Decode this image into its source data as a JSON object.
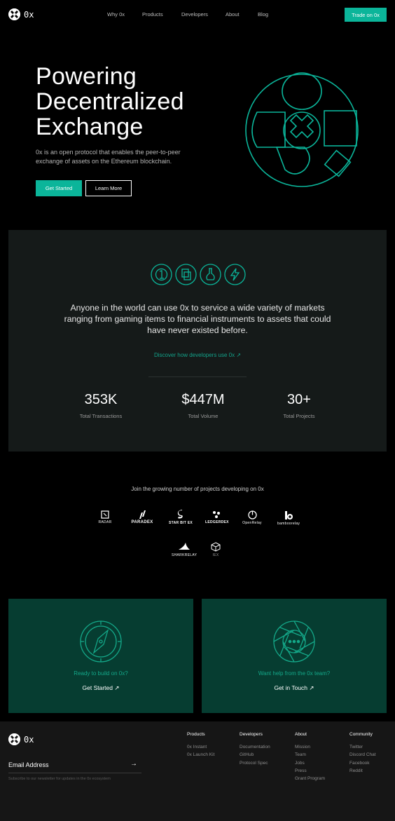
{
  "nav": {
    "logo_text": "0x",
    "links": [
      "Why 0x",
      "Products",
      "Developers",
      "About",
      "Blog"
    ],
    "cta_label": "Trade on 0x"
  },
  "hero": {
    "title_lines": [
      "Powering",
      "Decentralized",
      "Exchange"
    ],
    "subtitle": "0x is an open protocol that enables the peer-to-peer exchange of assets on the Ethereum blockchain.",
    "primary_button": "Get Started",
    "secondary_button": "Learn More"
  },
  "stats_panel": {
    "icons": [
      "coin-icon",
      "documents-icon",
      "flask-icon",
      "lightning-icon"
    ],
    "description": "Anyone in the world can use 0x to service a wide variety of markets ranging from gaming items to financial instruments to assets that could have never existed before.",
    "link_label": "Discover how developers use 0x ↗",
    "stats": [
      {
        "value": "353K",
        "label": "Total Transactions"
      },
      {
        "value": "$447M",
        "label": "Total Volume"
      },
      {
        "value": "30+",
        "label": "Total Projects"
      }
    ]
  },
  "projects": {
    "title": "Join the growing number of projects developing on 0x",
    "logos": [
      "RADAR",
      "PARADEX",
      "STAR BIT EX",
      "LEDGERDEX",
      "OpenRelay",
      "bamboorelay",
      "SHARKRELAY",
      "IEX"
    ]
  },
  "cta_cards": [
    {
      "icon": "compass-icon",
      "line1": "Ready to build on 0x?",
      "line2": "Get Started ↗"
    },
    {
      "icon": "chat-aperture-icon",
      "line1": "Want help from the 0x team?",
      "line2": "Get in Touch ↗"
    }
  ],
  "footer": {
    "logo_text": "0x",
    "email_placeholder": "Email Address",
    "arrow": "→",
    "note": "Subscribe to our newsletter for updates in the 0x ecosystem",
    "columns": [
      {
        "title": "Products",
        "items": [
          "0x Instant",
          "0x Launch Kit"
        ]
      },
      {
        "title": "Developers",
        "items": [
          "Documentation",
          "GitHub",
          "Protocol Spec"
        ]
      },
      {
        "title": "About",
        "items": [
          "Mission",
          "Team",
          "Jobs",
          "Press",
          "Grant Program"
        ]
      },
      {
        "title": "Community",
        "items": [
          "Twitter",
          "Discord Chat",
          "Facebook",
          "Reddit"
        ]
      }
    ]
  },
  "colors": {
    "accent": "#0bb59a",
    "panel": "#151a19",
    "cta_card": "#063d31",
    "footer": "#161616"
  }
}
